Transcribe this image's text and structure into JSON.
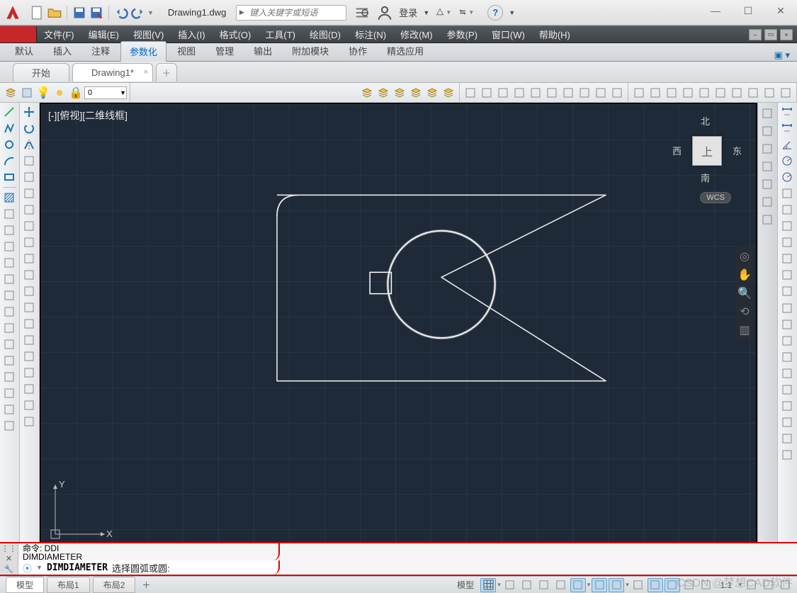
{
  "app": {
    "document": "Drawing1.dwg",
    "login_label": "登录"
  },
  "search": {
    "placeholder": "键入关键字或短语"
  },
  "menus": [
    "文件(F)",
    "编辑(E)",
    "视图(V)",
    "插入(I)",
    "格式(O)",
    "工具(T)",
    "绘图(D)",
    "标注(N)",
    "修改(M)",
    "参数(P)",
    "窗口(W)",
    "帮助(H)"
  ],
  "ribbon_tabs": [
    "默认",
    "插入",
    "注释",
    "参数化",
    "视图",
    "管理",
    "输出",
    "附加模块",
    "协作",
    "精选应用"
  ],
  "ribbon_active_index": 3,
  "file_tabs": {
    "items": [
      "开始",
      "Drawing1*"
    ],
    "active_index": 1
  },
  "viewport_label": "[-][俯视][二维线框]",
  "viewcube": {
    "top": "北",
    "left": "西",
    "right": "东",
    "bottom": "南",
    "face": "上",
    "wcs": "WCS"
  },
  "command": {
    "hist_line1": "命令: DDI",
    "hist_line2": "DIMDIAMETER",
    "prompt_cmd": "DIMDIAMETER",
    "prompt_text": "选择圆弧或圆:"
  },
  "status": {
    "layouts": [
      "模型",
      "布局1",
      "布局2"
    ],
    "active_layout": 0,
    "model_label": "模型",
    "scale": "1:1"
  },
  "coord": {
    "x": "X",
    "y": "Y"
  },
  "watermark": "CSDN @梦想CAD软件"
}
